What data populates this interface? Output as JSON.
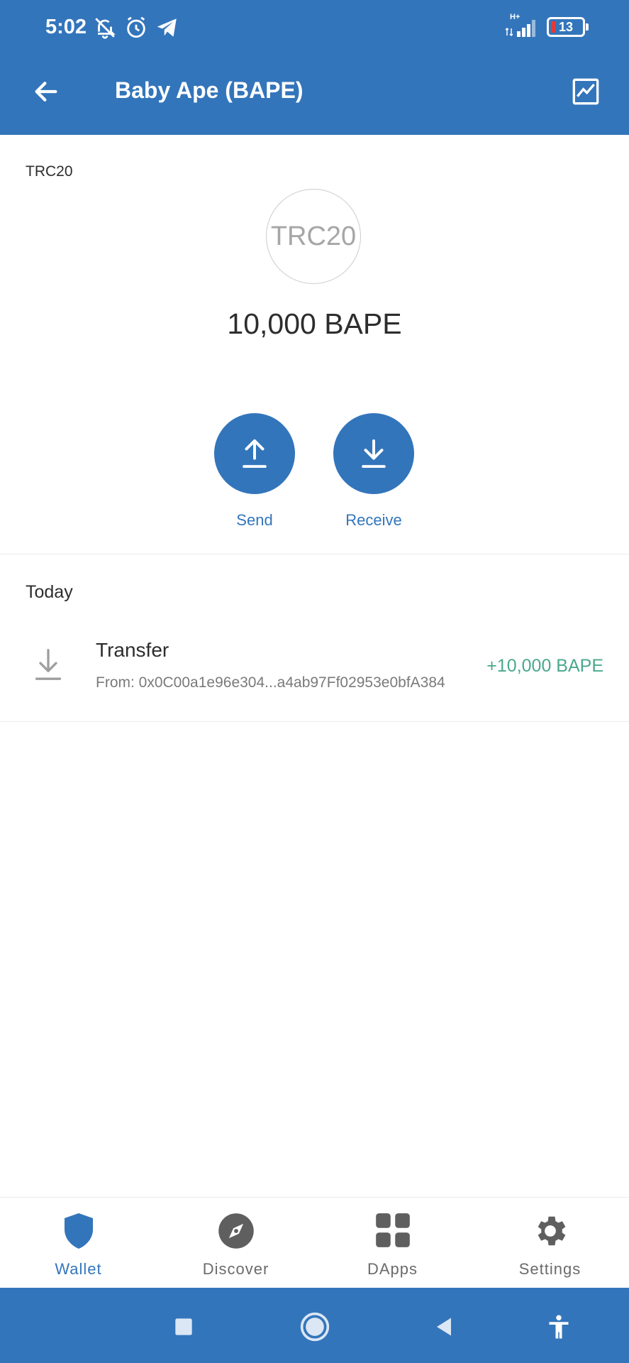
{
  "status_bar": {
    "time": "5:02",
    "network": "H+",
    "battery": "13"
  },
  "header": {
    "title": "Baby Ape (BAPE)"
  },
  "token": {
    "standard": "TRC20",
    "logo_text": "TRC20",
    "balance": "10,000 BAPE"
  },
  "actions": {
    "send_label": "Send",
    "receive_label": "Receive"
  },
  "history": {
    "section_title": "Today",
    "transactions": [
      {
        "type": "Transfer",
        "from": "From: 0x0C00a1e96e304...a4ab97Ff02953e0bfA384",
        "amount": "+10,000 BAPE"
      }
    ]
  },
  "bottom_nav": {
    "items": [
      {
        "label": "Wallet",
        "icon": "shield-icon",
        "active": true
      },
      {
        "label": "Discover",
        "icon": "compass-icon",
        "active": false
      },
      {
        "label": "DApps",
        "icon": "grid-icon",
        "active": false
      },
      {
        "label": "Settings",
        "icon": "gear-icon",
        "active": false
      }
    ]
  },
  "colors": {
    "primary": "#3375bb",
    "positive": "#4aa88c",
    "muted": "#7a7a7a"
  }
}
